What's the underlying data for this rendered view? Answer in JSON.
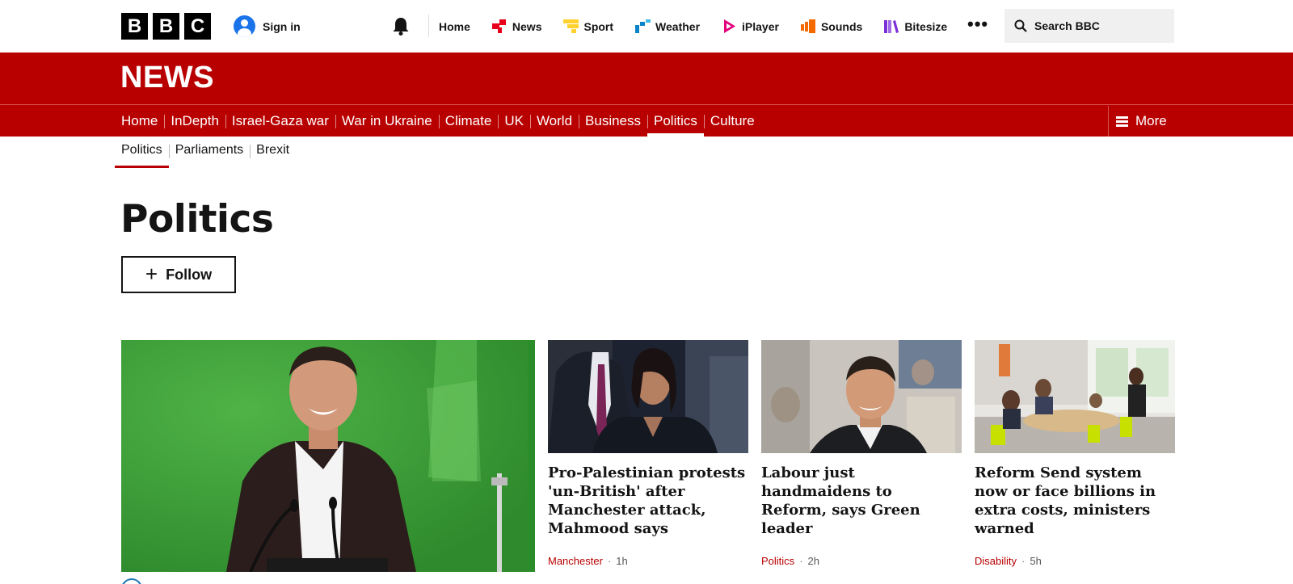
{
  "header": {
    "logo_letters": [
      "B",
      "B",
      "C"
    ],
    "signin_label": "Sign in",
    "nav": [
      {
        "label": "Home",
        "icon": "none"
      },
      {
        "label": "News",
        "icon": "news-icon",
        "color": "#e6001c"
      },
      {
        "label": "Sport",
        "icon": "sport-icon",
        "color": "#ffd230"
      },
      {
        "label": "Weather",
        "icon": "weather-icon",
        "color": "#0a84c8"
      },
      {
        "label": "iPlayer",
        "icon": "iplayer-icon",
        "color": "#e2007a"
      },
      {
        "label": "Sounds",
        "icon": "sounds-icon",
        "color": "#f56a00"
      },
      {
        "label": "Bitesize",
        "icon": "bitesize-icon",
        "color": "#7b2fd6"
      }
    ],
    "more_label": "•••",
    "search_placeholder": "Search BBC"
  },
  "news_band": {
    "title": "NEWS",
    "color": "#b80000",
    "sections": [
      "Home",
      "InDepth",
      "Israel-Gaza war",
      "War in Ukraine",
      "Climate",
      "UK",
      "World",
      "Business",
      "Politics",
      "Culture"
    ],
    "active_section": "Politics",
    "more_label": "More"
  },
  "subnav": {
    "items": [
      "Politics",
      "Parliaments",
      "Brexit"
    ],
    "active": "Politics"
  },
  "page": {
    "title": "Politics",
    "follow_label": "Follow"
  },
  "cards": [
    {
      "headline": "Pro-Palestinian protests 'un-British' after Manchester attack, Mahmood says",
      "tag": "Manchester",
      "time": "1h"
    },
    {
      "headline": "Labour just handmaidens to Reform, says Green leader",
      "tag": "Politics",
      "time": "2h"
    },
    {
      "headline": "Reform Send system now or face billions in extra costs, ministers warned",
      "tag": "Disability",
      "time": "5h"
    }
  ]
}
